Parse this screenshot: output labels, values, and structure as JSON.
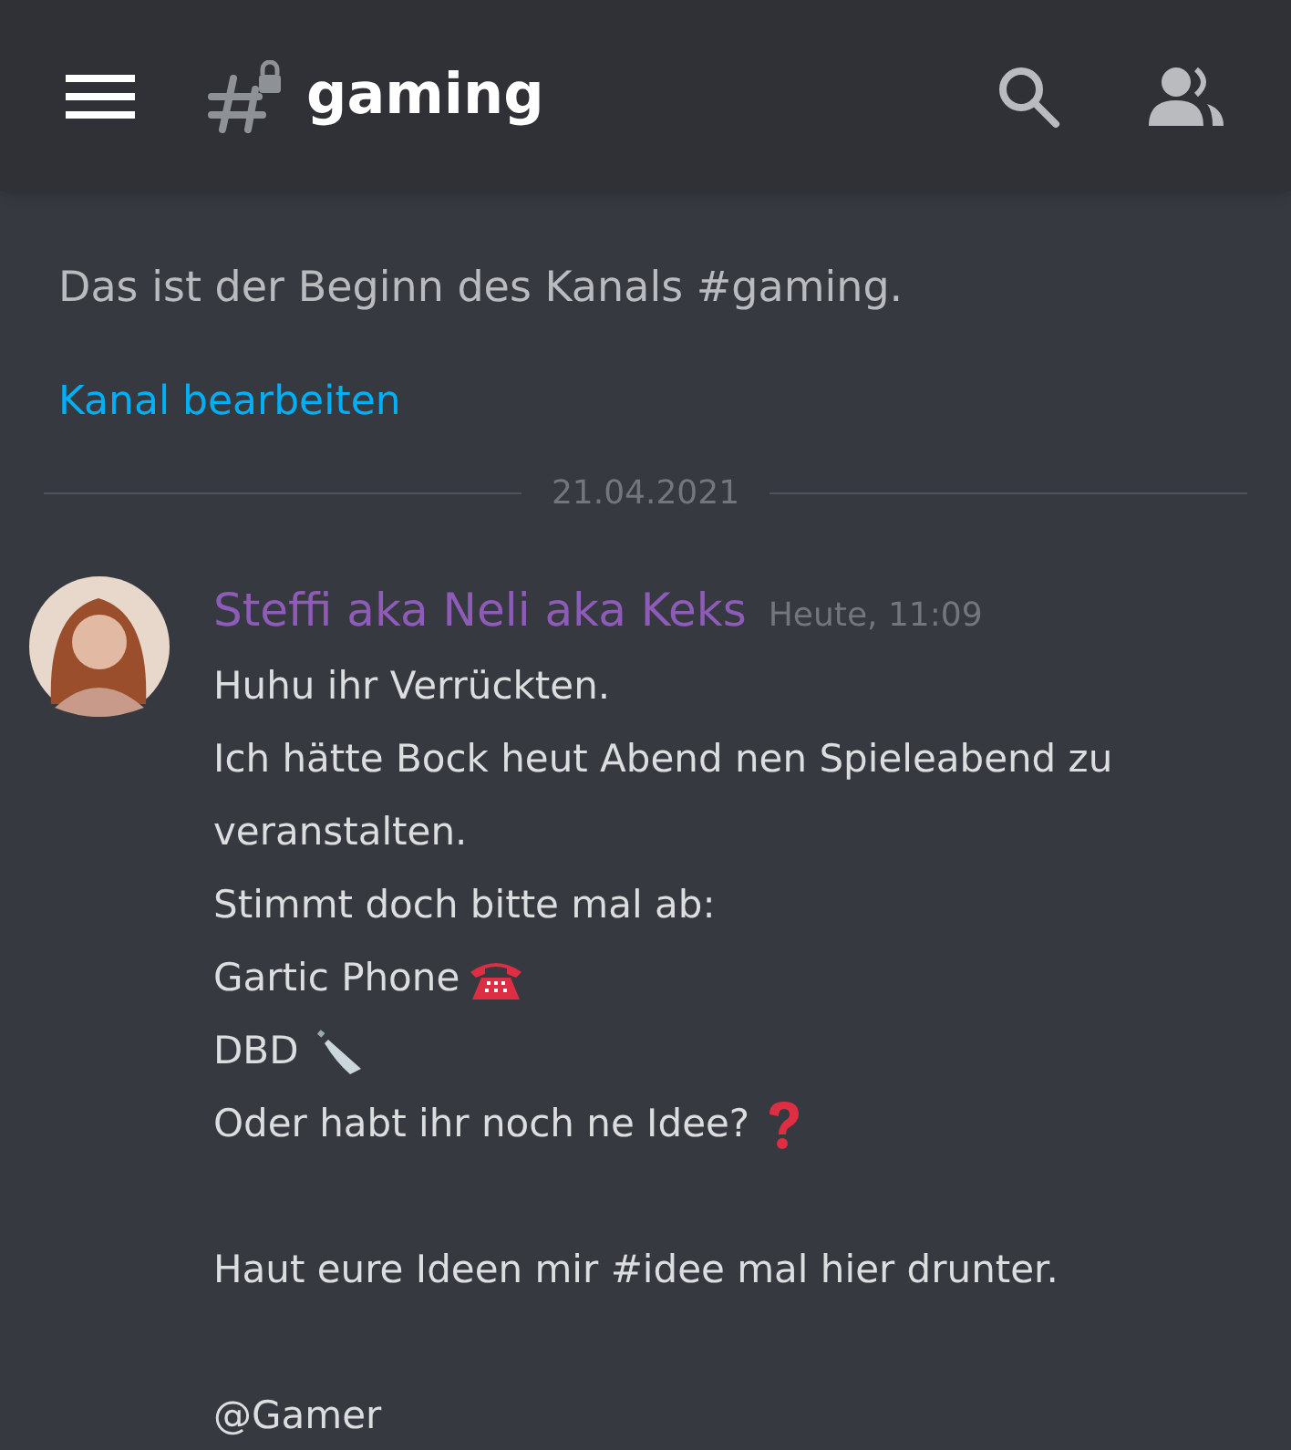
{
  "header": {
    "channel": "gaming",
    "locked": true
  },
  "intro": {
    "text": "Das ist der Beginn des Kanals #gaming.",
    "link": "Kanal bearbeiten"
  },
  "divider": {
    "date": "21.04.2021"
  },
  "message": {
    "author": "Steffi aka Neli aka Keks",
    "color": "#8e5bb8",
    "time": "Heute, 11:09",
    "lines": [
      {
        "text": "Huhu ihr Verrückten.",
        "kind": "plain"
      },
      {
        "text": "Ich hätte Bock heut Abend nen Spieleabend zu",
        "kind": "plain"
      },
      {
        "text": "veranstalten.",
        "kind": "plain"
      },
      {
        "text": "Stimmt doch bitte mal ab:",
        "kind": "plain"
      },
      {
        "text": "Gartic Phone",
        "kind": "telephone"
      },
      {
        "text": "DBD",
        "kind": "knife"
      },
      {
        "text": "Oder habt ihr noch ne Idee?",
        "kind": "question"
      },
      {
        "text": "Haut eure Ideen mir #idee mal hier drunter.",
        "kind": "spaced"
      },
      {
        "text": "@Gamer",
        "kind": "spaced"
      }
    ]
  }
}
